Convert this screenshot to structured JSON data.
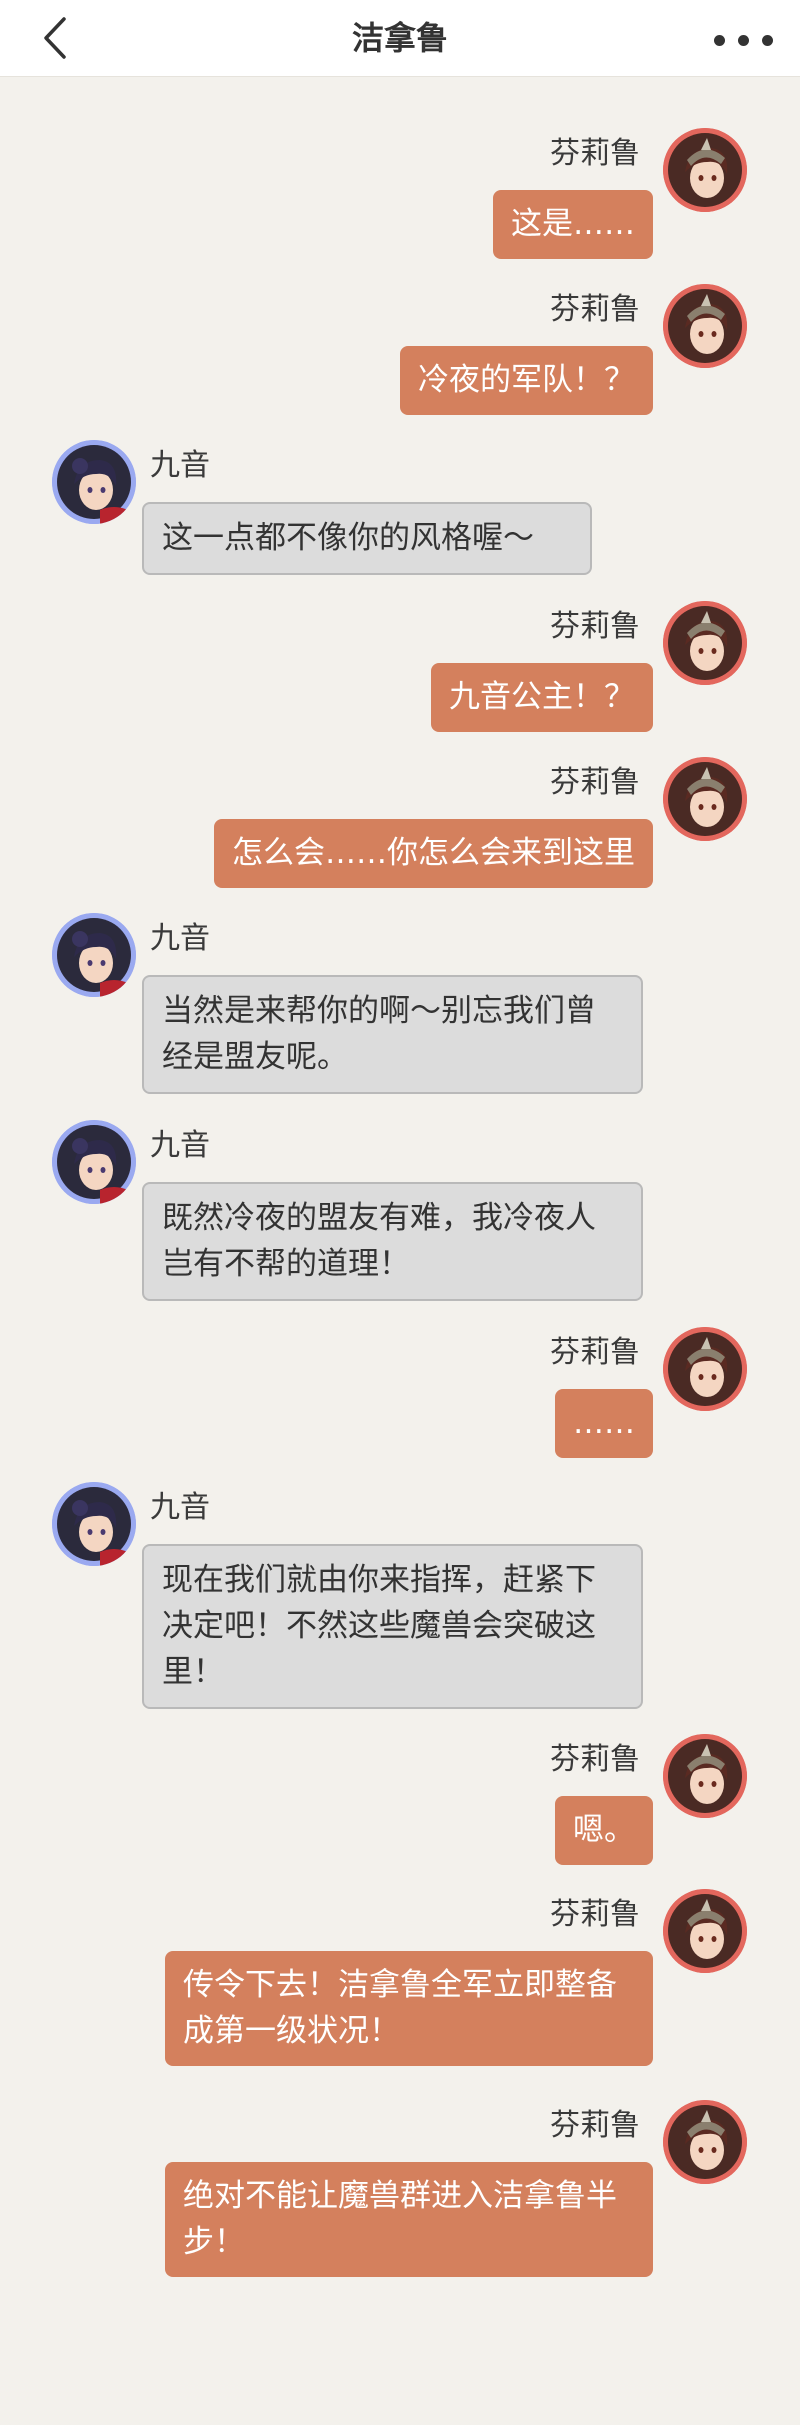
{
  "header": {
    "title": "洁拿鲁",
    "back_icon": "chevron-left-icon",
    "more_icon": "more-dots-icon"
  },
  "colors": {
    "background": "#f3f1ec",
    "outgoing_bubble": "#d4805d",
    "incoming_bubble": "#dcdcdc",
    "outgoing_avatar_ring": "#e3675d",
    "incoming_avatar_ring": "#9aa9f0"
  },
  "messages": [
    {
      "side": "right",
      "name": "芬莉鲁",
      "text": "这是……"
    },
    {
      "side": "right",
      "name": "芬莉鲁",
      "text": "冷夜的军队！？"
    },
    {
      "side": "left",
      "name": "九音",
      "text": "这一点都不像你的风格喔～"
    },
    {
      "side": "right",
      "name": "芬莉鲁",
      "text": "九音公主！？"
    },
    {
      "side": "right",
      "name": "芬莉鲁",
      "text": "怎么会……你怎么会来到这里"
    },
    {
      "side": "left",
      "name": "九音",
      "text": "当然是来帮你的啊～别忘我们曾经是盟友呢。"
    },
    {
      "side": "left",
      "name": "九音",
      "text": "既然冷夜的盟友有难，我冷夜人岂有不帮的道理！"
    },
    {
      "side": "right",
      "name": "芬莉鲁",
      "text": "……"
    },
    {
      "side": "left",
      "name": "九音",
      "text": "现在我们就由你来指挥，赶紧下决定吧！不然这些魔兽会突破这里！"
    },
    {
      "side": "right",
      "name": "芬莉鲁",
      "text": "嗯。"
    },
    {
      "side": "right",
      "name": "芬莉鲁",
      "text": "传令下去！洁拿鲁全军立即整备成第一级状况！"
    },
    {
      "side": "right",
      "name": "芬莉鲁",
      "text": "绝对不能让魔兽群进入洁拿鲁半步！"
    }
  ]
}
